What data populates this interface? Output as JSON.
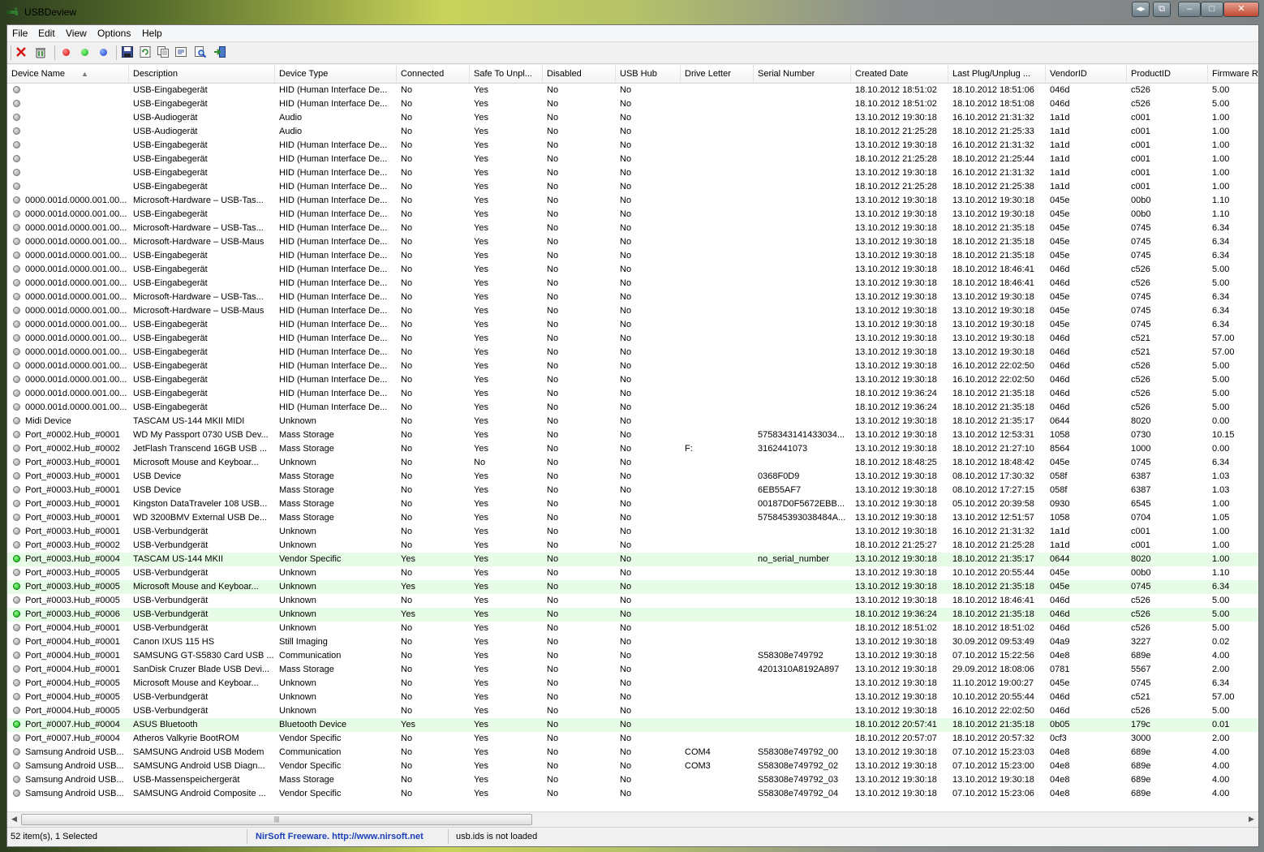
{
  "window": {
    "title": "USBDeview",
    "buttons": [
      "◂▸",
      "⧉",
      "–",
      "□",
      "✕"
    ]
  },
  "menu": [
    "File",
    "Edit",
    "View",
    "Options",
    "Help"
  ],
  "toolbar": [
    "close-red-x-icon",
    "uninstall-icon",
    "disconnect-red-dot-icon",
    "connect-green-dot-icon",
    "blue-dot-icon",
    "save-icon",
    "refresh-icon",
    "copy-icon",
    "properties-icon",
    "find-icon",
    "exit-icon"
  ],
  "colors": {
    "connected_row": "#e6fce6",
    "connected_dot": "#11a811",
    "disconnected_dot": "#8e8e8e",
    "link": "#1a3fb8"
  },
  "columns": [
    "Device Name",
    "Description",
    "Device Type",
    "Connected",
    "Safe To Unpl...",
    "Disabled",
    "USB Hub",
    "Drive Letter",
    "Serial Number",
    "Created Date",
    "Last Plug/Unplug ...",
    "VendorID",
    "ProductID",
    "Firmware R"
  ],
  "rows": [
    {
      "c": [
        "",
        "USB-Eingabegerät",
        "HID (Human Interface De...",
        "No",
        "Yes",
        "No",
        "No",
        "",
        "",
        "18.10.2012 18:51:02",
        "18.10.2012 18:51:06",
        "046d",
        "c526",
        "5.00"
      ],
      "on": false
    },
    {
      "c": [
        "",
        "USB-Eingabegerät",
        "HID (Human Interface De...",
        "No",
        "Yes",
        "No",
        "No",
        "",
        "",
        "18.10.2012 18:51:02",
        "18.10.2012 18:51:08",
        "046d",
        "c526",
        "5.00"
      ],
      "on": false
    },
    {
      "c": [
        "",
        "USB-Audiogerät",
        "Audio",
        "No",
        "Yes",
        "No",
        "No",
        "",
        "",
        "13.10.2012 19:30:18",
        "16.10.2012 21:31:32",
        "1a1d",
        "c001",
        "1.00"
      ],
      "on": false
    },
    {
      "c": [
        "",
        "USB-Audiogerät",
        "Audio",
        "No",
        "Yes",
        "No",
        "No",
        "",
        "",
        "18.10.2012 21:25:28",
        "18.10.2012 21:25:33",
        "1a1d",
        "c001",
        "1.00"
      ],
      "on": false
    },
    {
      "c": [
        "",
        "USB-Eingabegerät",
        "HID (Human Interface De...",
        "No",
        "Yes",
        "No",
        "No",
        "",
        "",
        "13.10.2012 19:30:18",
        "16.10.2012 21:31:32",
        "1a1d",
        "c001",
        "1.00"
      ],
      "on": false
    },
    {
      "c": [
        "",
        "USB-Eingabegerät",
        "HID (Human Interface De...",
        "No",
        "Yes",
        "No",
        "No",
        "",
        "",
        "18.10.2012 21:25:28",
        "18.10.2012 21:25:44",
        "1a1d",
        "c001",
        "1.00"
      ],
      "on": false
    },
    {
      "c": [
        "",
        "USB-Eingabegerät",
        "HID (Human Interface De...",
        "No",
        "Yes",
        "No",
        "No",
        "",
        "",
        "13.10.2012 19:30:18",
        "16.10.2012 21:31:32",
        "1a1d",
        "c001",
        "1.00"
      ],
      "on": false
    },
    {
      "c": [
        "",
        "USB-Eingabegerät",
        "HID (Human Interface De...",
        "No",
        "Yes",
        "No",
        "No",
        "",
        "",
        "18.10.2012 21:25:28",
        "18.10.2012 21:25:38",
        "1a1d",
        "c001",
        "1.00"
      ],
      "on": false
    },
    {
      "c": [
        "0000.001d.0000.001.00...",
        "Microsoft-Hardware – USB-Tas...",
        "HID (Human Interface De...",
        "No",
        "Yes",
        "No",
        "No",
        "",
        "",
        "13.10.2012 19:30:18",
        "13.10.2012 19:30:18",
        "045e",
        "00b0",
        "1.10"
      ],
      "on": false
    },
    {
      "c": [
        "0000.001d.0000.001.00...",
        "USB-Eingabegerät",
        "HID (Human Interface De...",
        "No",
        "Yes",
        "No",
        "No",
        "",
        "",
        "13.10.2012 19:30:18",
        "13.10.2012 19:30:18",
        "045e",
        "00b0",
        "1.10"
      ],
      "on": false
    },
    {
      "c": [
        "0000.001d.0000.001.00...",
        "Microsoft-Hardware – USB-Tas...",
        "HID (Human Interface De...",
        "No",
        "Yes",
        "No",
        "No",
        "",
        "",
        "13.10.2012 19:30:18",
        "18.10.2012 21:35:18",
        "045e",
        "0745",
        "6.34"
      ],
      "on": false
    },
    {
      "c": [
        "0000.001d.0000.001.00...",
        "Microsoft-Hardware – USB-Maus",
        "HID (Human Interface De...",
        "No",
        "Yes",
        "No",
        "No",
        "",
        "",
        "13.10.2012 19:30:18",
        "18.10.2012 21:35:18",
        "045e",
        "0745",
        "6.34"
      ],
      "on": false
    },
    {
      "c": [
        "0000.001d.0000.001.00...",
        "USB-Eingabegerät",
        "HID (Human Interface De...",
        "No",
        "Yes",
        "No",
        "No",
        "",
        "",
        "13.10.2012 19:30:18",
        "18.10.2012 21:35:18",
        "045e",
        "0745",
        "6.34"
      ],
      "on": false
    },
    {
      "c": [
        "0000.001d.0000.001.00...",
        "USB-Eingabegerät",
        "HID (Human Interface De...",
        "No",
        "Yes",
        "No",
        "No",
        "",
        "",
        "13.10.2012 19:30:18",
        "18.10.2012 18:46:41",
        "046d",
        "c526",
        "5.00"
      ],
      "on": false
    },
    {
      "c": [
        "0000.001d.0000.001.00...",
        "USB-Eingabegerät",
        "HID (Human Interface De...",
        "No",
        "Yes",
        "No",
        "No",
        "",
        "",
        "13.10.2012 19:30:18",
        "18.10.2012 18:46:41",
        "046d",
        "c526",
        "5.00"
      ],
      "on": false
    },
    {
      "c": [
        "0000.001d.0000.001.00...",
        "Microsoft-Hardware – USB-Tas...",
        "HID (Human Interface De...",
        "No",
        "Yes",
        "No",
        "No",
        "",
        "",
        "13.10.2012 19:30:18",
        "13.10.2012 19:30:18",
        "045e",
        "0745",
        "6.34"
      ],
      "on": false
    },
    {
      "c": [
        "0000.001d.0000.001.00...",
        "Microsoft-Hardware – USB-Maus",
        "HID (Human Interface De...",
        "No",
        "Yes",
        "No",
        "No",
        "",
        "",
        "13.10.2012 19:30:18",
        "13.10.2012 19:30:18",
        "045e",
        "0745",
        "6.34"
      ],
      "on": false
    },
    {
      "c": [
        "0000.001d.0000.001.00...",
        "USB-Eingabegerät",
        "HID (Human Interface De...",
        "No",
        "Yes",
        "No",
        "No",
        "",
        "",
        "13.10.2012 19:30:18",
        "13.10.2012 19:30:18",
        "045e",
        "0745",
        "6.34"
      ],
      "on": false
    },
    {
      "c": [
        "0000.001d.0000.001.00...",
        "USB-Eingabegerät",
        "HID (Human Interface De...",
        "No",
        "Yes",
        "No",
        "No",
        "",
        "",
        "13.10.2012 19:30:18",
        "13.10.2012 19:30:18",
        "046d",
        "c521",
        "57.00"
      ],
      "on": false
    },
    {
      "c": [
        "0000.001d.0000.001.00...",
        "USB-Eingabegerät",
        "HID (Human Interface De...",
        "No",
        "Yes",
        "No",
        "No",
        "",
        "",
        "13.10.2012 19:30:18",
        "13.10.2012 19:30:18",
        "046d",
        "c521",
        "57.00"
      ],
      "on": false
    },
    {
      "c": [
        "0000.001d.0000.001.00...",
        "USB-Eingabegerät",
        "HID (Human Interface De...",
        "No",
        "Yes",
        "No",
        "No",
        "",
        "",
        "13.10.2012 19:30:18",
        "16.10.2012 22:02:50",
        "046d",
        "c526",
        "5.00"
      ],
      "on": false
    },
    {
      "c": [
        "0000.001d.0000.001.00...",
        "USB-Eingabegerät",
        "HID (Human Interface De...",
        "No",
        "Yes",
        "No",
        "No",
        "",
        "",
        "13.10.2012 19:30:18",
        "16.10.2012 22:02:50",
        "046d",
        "c526",
        "5.00"
      ],
      "on": false
    },
    {
      "c": [
        "0000.001d.0000.001.00...",
        "USB-Eingabegerät",
        "HID (Human Interface De...",
        "No",
        "Yes",
        "No",
        "No",
        "",
        "",
        "18.10.2012 19:36:24",
        "18.10.2012 21:35:18",
        "046d",
        "c526",
        "5.00"
      ],
      "on": false
    },
    {
      "c": [
        "0000.001d.0000.001.00...",
        "USB-Eingabegerät",
        "HID (Human Interface De...",
        "No",
        "Yes",
        "No",
        "No",
        "",
        "",
        "18.10.2012 19:36:24",
        "18.10.2012 21:35:18",
        "046d",
        "c526",
        "5.00"
      ],
      "on": false
    },
    {
      "c": [
        "Midi Device",
        "TASCAM US-144 MKII MIDI",
        "Unknown",
        "No",
        "Yes",
        "No",
        "No",
        "",
        "",
        "13.10.2012 19:30:18",
        "18.10.2012 21:35:17",
        "0644",
        "8020",
        "0.00"
      ],
      "on": false
    },
    {
      "c": [
        "Port_#0002.Hub_#0001",
        "WD My Passport 0730 USB Dev...",
        "Mass Storage",
        "No",
        "Yes",
        "No",
        "No",
        "",
        "5758343141433034...",
        "13.10.2012 19:30:18",
        "13.10.2012 12:53:31",
        "1058",
        "0730",
        "10.15"
      ],
      "on": false
    },
    {
      "c": [
        "Port_#0002.Hub_#0002",
        "JetFlash Transcend 16GB USB ...",
        "Mass Storage",
        "No",
        "Yes",
        "No",
        "No",
        "F:",
        "3162441073",
        "13.10.2012 19:30:18",
        "18.10.2012 21:27:10",
        "8564",
        "1000",
        "0.00"
      ],
      "on": false
    },
    {
      "c": [
        "Port_#0003.Hub_#0001",
        "Microsoft Mouse and Keyboar...",
        "Unknown",
        "No",
        "No",
        "No",
        "No",
        "",
        "",
        "18.10.2012 18:48:25",
        "18.10.2012 18:48:42",
        "045e",
        "0745",
        "6.34"
      ],
      "on": false
    },
    {
      "c": [
        "Port_#0003.Hub_#0001",
        "USB Device",
        "Mass Storage",
        "No",
        "Yes",
        "No",
        "No",
        "",
        "0368F0D9",
        "13.10.2012 19:30:18",
        "08.10.2012 17:30:32",
        "058f",
        "6387",
        "1.03"
      ],
      "on": false
    },
    {
      "c": [
        "Port_#0003.Hub_#0001",
        "USB Device",
        "Mass Storage",
        "No",
        "Yes",
        "No",
        "No",
        "",
        "6EB55AF7",
        "13.10.2012 19:30:18",
        "08.10.2012 17:27:15",
        "058f",
        "6387",
        "1.03"
      ],
      "on": false
    },
    {
      "c": [
        "Port_#0003.Hub_#0001",
        "Kingston DataTraveler 108 USB...",
        "Mass Storage",
        "No",
        "Yes",
        "No",
        "No",
        "",
        "00187D0F5672EBB...",
        "13.10.2012 19:30:18",
        "05.10.2012 20:39:58",
        "0930",
        "6545",
        "1.00"
      ],
      "on": false
    },
    {
      "c": [
        "Port_#0003.Hub_#0001",
        "WD 3200BMV External USB De...",
        "Mass Storage",
        "No",
        "Yes",
        "No",
        "No",
        "",
        "575845393038484A...",
        "13.10.2012 19:30:18",
        "13.10.2012 12:51:57",
        "1058",
        "0704",
        "1.05"
      ],
      "on": false
    },
    {
      "c": [
        "Port_#0003.Hub_#0001",
        "USB-Verbundgerät",
        "Unknown",
        "No",
        "Yes",
        "No",
        "No",
        "",
        "",
        "13.10.2012 19:30:18",
        "16.10.2012 21:31:32",
        "1a1d",
        "c001",
        "1.00"
      ],
      "on": false
    },
    {
      "c": [
        "Port_#0003.Hub_#0002",
        "USB-Verbundgerät",
        "Unknown",
        "No",
        "Yes",
        "No",
        "No",
        "",
        "",
        "18.10.2012 21:25:27",
        "18.10.2012 21:25:28",
        "1a1d",
        "c001",
        "1.00"
      ],
      "on": false
    },
    {
      "c": [
        "Port_#0003.Hub_#0004",
        "TASCAM US-144 MKII",
        "Vendor Specific",
        "Yes",
        "Yes",
        "No",
        "No",
        "",
        "no_serial_number",
        "13.10.2012 19:30:18",
        "18.10.2012 21:35:17",
        "0644",
        "8020",
        "1.00"
      ],
      "on": true
    },
    {
      "c": [
        "Port_#0003.Hub_#0005",
        "USB-Verbundgerät",
        "Unknown",
        "No",
        "Yes",
        "No",
        "No",
        "",
        "",
        "13.10.2012 19:30:18",
        "10.10.2012 20:55:44",
        "045e",
        "00b0",
        "1.10"
      ],
      "on": false
    },
    {
      "c": [
        "Port_#0003.Hub_#0005",
        "Microsoft Mouse and Keyboar...",
        "Unknown",
        "Yes",
        "Yes",
        "No",
        "No",
        "",
        "",
        "13.10.2012 19:30:18",
        "18.10.2012 21:35:18",
        "045e",
        "0745",
        "6.34"
      ],
      "on": true
    },
    {
      "c": [
        "Port_#0003.Hub_#0005",
        "USB-Verbundgerät",
        "Unknown",
        "No",
        "Yes",
        "No",
        "No",
        "",
        "",
        "13.10.2012 19:30:18",
        "18.10.2012 18:46:41",
        "046d",
        "c526",
        "5.00"
      ],
      "on": false
    },
    {
      "c": [
        "Port_#0003.Hub_#0006",
        "USB-Verbundgerät",
        "Unknown",
        "Yes",
        "Yes",
        "No",
        "No",
        "",
        "",
        "18.10.2012 19:36:24",
        "18.10.2012 21:35:18",
        "046d",
        "c526",
        "5.00"
      ],
      "on": true
    },
    {
      "c": [
        "Port_#0004.Hub_#0001",
        "USB-Verbundgerät",
        "Unknown",
        "No",
        "Yes",
        "No",
        "No",
        "",
        "",
        "18.10.2012 18:51:02",
        "18.10.2012 18:51:02",
        "046d",
        "c526",
        "5.00"
      ],
      "on": false
    },
    {
      "c": [
        "Port_#0004.Hub_#0001",
        "Canon IXUS 115 HS",
        "Still Imaging",
        "No",
        "Yes",
        "No",
        "No",
        "",
        "",
        "13.10.2012 19:30:18",
        "30.09.2012 09:53:49",
        "04a9",
        "3227",
        "0.02"
      ],
      "on": false
    },
    {
      "c": [
        "Port_#0004.Hub_#0001",
        "SAMSUNG GT-S5830 Card USB ...",
        "Communication",
        "No",
        "Yes",
        "No",
        "No",
        "",
        "S58308e749792",
        "13.10.2012 19:30:18",
        "07.10.2012 15:22:56",
        "04e8",
        "689e",
        "4.00"
      ],
      "on": false
    },
    {
      "c": [
        "Port_#0004.Hub_#0001",
        "SanDisk Cruzer Blade USB Devi...",
        "Mass Storage",
        "No",
        "Yes",
        "No",
        "No",
        "",
        "4201310A8192A897",
        "13.10.2012 19:30:18",
        "29.09.2012 18:08:06",
        "0781",
        "5567",
        "2.00"
      ],
      "on": false
    },
    {
      "c": [
        "Port_#0004.Hub_#0005",
        "Microsoft Mouse and Keyboar...",
        "Unknown",
        "No",
        "Yes",
        "No",
        "No",
        "",
        "",
        "13.10.2012 19:30:18",
        "11.10.2012 19:00:27",
        "045e",
        "0745",
        "6.34"
      ],
      "on": false
    },
    {
      "c": [
        "Port_#0004.Hub_#0005",
        "USB-Verbundgerät",
        "Unknown",
        "No",
        "Yes",
        "No",
        "No",
        "",
        "",
        "13.10.2012 19:30:18",
        "10.10.2012 20:55:44",
        "046d",
        "c521",
        "57.00"
      ],
      "on": false
    },
    {
      "c": [
        "Port_#0004.Hub_#0005",
        "USB-Verbundgerät",
        "Unknown",
        "No",
        "Yes",
        "No",
        "No",
        "",
        "",
        "13.10.2012 19:30:18",
        "16.10.2012 22:02:50",
        "046d",
        "c526",
        "5.00"
      ],
      "on": false
    },
    {
      "c": [
        "Port_#0007.Hub_#0004",
        "ASUS Bluetooth",
        "Bluetooth Device",
        "Yes",
        "Yes",
        "No",
        "No",
        "",
        "",
        "18.10.2012 20:57:41",
        "18.10.2012 21:35:18",
        "0b05",
        "179c",
        "0.01"
      ],
      "on": true
    },
    {
      "c": [
        "Port_#0007.Hub_#0004",
        "Atheros Valkyrie BootROM",
        "Vendor Specific",
        "No",
        "Yes",
        "No",
        "No",
        "",
        "",
        "18.10.2012 20:57:07",
        "18.10.2012 20:57:32",
        "0cf3",
        "3000",
        "2.00"
      ],
      "on": false
    },
    {
      "c": [
        "Samsung Android USB...",
        "SAMSUNG Android USB Modem",
        "Communication",
        "No",
        "Yes",
        "No",
        "No",
        "COM4",
        "S58308e749792_00",
        "13.10.2012 19:30:18",
        "07.10.2012 15:23:03",
        "04e8",
        "689e",
        "4.00"
      ],
      "on": false
    },
    {
      "c": [
        "Samsung Android USB...",
        "SAMSUNG Android USB Diagn...",
        "Vendor Specific",
        "No",
        "Yes",
        "No",
        "No",
        "COM3",
        "S58308e749792_02",
        "13.10.2012 19:30:18",
        "07.10.2012 15:23:00",
        "04e8",
        "689e",
        "4.00"
      ],
      "on": false
    },
    {
      "c": [
        "Samsung Android USB...",
        "USB-Massenspeichergerät",
        "Mass Storage",
        "No",
        "Yes",
        "No",
        "No",
        "",
        "S58308e749792_03",
        "13.10.2012 19:30:18",
        "13.10.2012 19:30:18",
        "04e8",
        "689e",
        "4.00"
      ],
      "on": false
    },
    {
      "c": [
        "Samsung Android USB...",
        "SAMSUNG Android Composite ...",
        "Vendor Specific",
        "No",
        "Yes",
        "No",
        "No",
        "",
        "S58308e749792_04",
        "13.10.2012 19:30:18",
        "07.10.2012 15:23:06",
        "04e8",
        "689e",
        "4.00"
      ],
      "on": false
    }
  ],
  "statusbar": {
    "items": "52 item(s), 1 Selected",
    "credit": "NirSoft Freeware.  http://www.nirsoft.net",
    "ids": "usb.ids is not loaded"
  }
}
